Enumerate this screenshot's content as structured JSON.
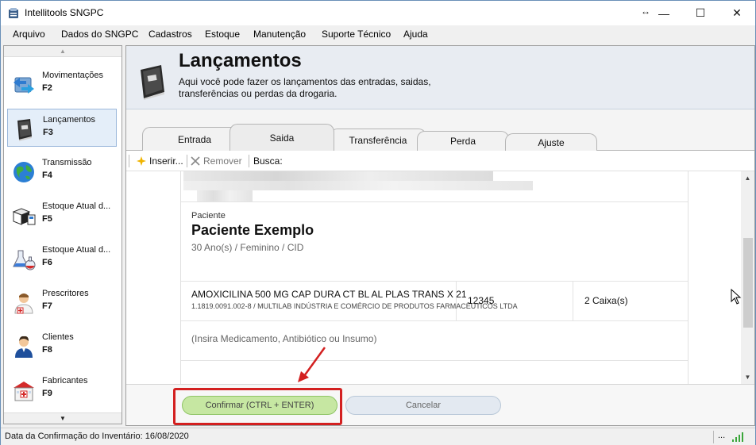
{
  "window": {
    "title": "Intellitools SNGPC",
    "controls": {
      "minimize": "—",
      "maximize": "☐",
      "close": "✕",
      "resize": "↔"
    }
  },
  "menu": [
    "Arquivo",
    "Dados do SNGPC",
    "Cadastros",
    "Estoque",
    "Manutenção",
    "Suporte Técnico",
    "Ajuda"
  ],
  "sidebar": {
    "scroll_up": "▲",
    "scroll_down": "▼",
    "items": [
      {
        "label": "Movimentações",
        "key": "F2",
        "icon": "movimentacoes-icon"
      },
      {
        "label": "Lançamentos",
        "key": "F3",
        "icon": "book-icon",
        "active": true
      },
      {
        "label": "Transmissão",
        "key": "F4",
        "icon": "globe-icon"
      },
      {
        "label": "Estoque Atual d...",
        "key": "F5",
        "icon": "boxes-icon"
      },
      {
        "label": "Estoque Atual d...",
        "key": "F6",
        "icon": "flask-icon"
      },
      {
        "label": "Prescritores",
        "key": "F7",
        "icon": "doctor-icon"
      },
      {
        "label": "Clientes",
        "key": "F8",
        "icon": "person-icon"
      },
      {
        "label": "Fabricantes",
        "key": "F9",
        "icon": "factory-icon"
      }
    ]
  },
  "header": {
    "title": "Lançamentos",
    "description": "Aqui você pode fazer os lançamentos das entradas, saidas, transferências ou perdas da drogaria."
  },
  "tabs": [
    {
      "label": "Entrada"
    },
    {
      "label": "Saida",
      "active": true
    },
    {
      "label": "Transferência"
    },
    {
      "label": "Perda"
    },
    {
      "label": "Ajuste"
    }
  ],
  "toolbar": {
    "insert": "Inserir...",
    "remove": "Remover",
    "search_label": "Busca:"
  },
  "patient": {
    "section_label": "Paciente",
    "name": "Paciente Exemplo",
    "info": "30 Ano(s) / Feminino / CID"
  },
  "medication": {
    "name": "AMOXICILINA 500 MG CAP DURA CT BL AL PLAS TRANS X 21",
    "details": "1.1819.0091.002-8 / MULTILAB INDÚSTRIA E COMÉRCIO DE PRODUTOS FARMACÊUTICOS LTDA",
    "code": "12345",
    "quantity": "2 Caixa(s)"
  },
  "insert_placeholder": "(Insira Medicamento, Antibiótico ou Insumo)",
  "scrollbar": {
    "up": "▲",
    "down": "▼"
  },
  "buttons": {
    "confirm": "Confirmar (CTRL + ENTER)",
    "cancel": "Cancelar"
  },
  "status": {
    "text": "Data da Confirmação do Inventário: 16/08/2020",
    "dots": "..."
  },
  "colors": {
    "highlight": "#d32020",
    "confirm_bg": "#c6e7a2",
    "cancel_bg": "#e3e9f1",
    "header_bg": "#e8ecf2"
  }
}
